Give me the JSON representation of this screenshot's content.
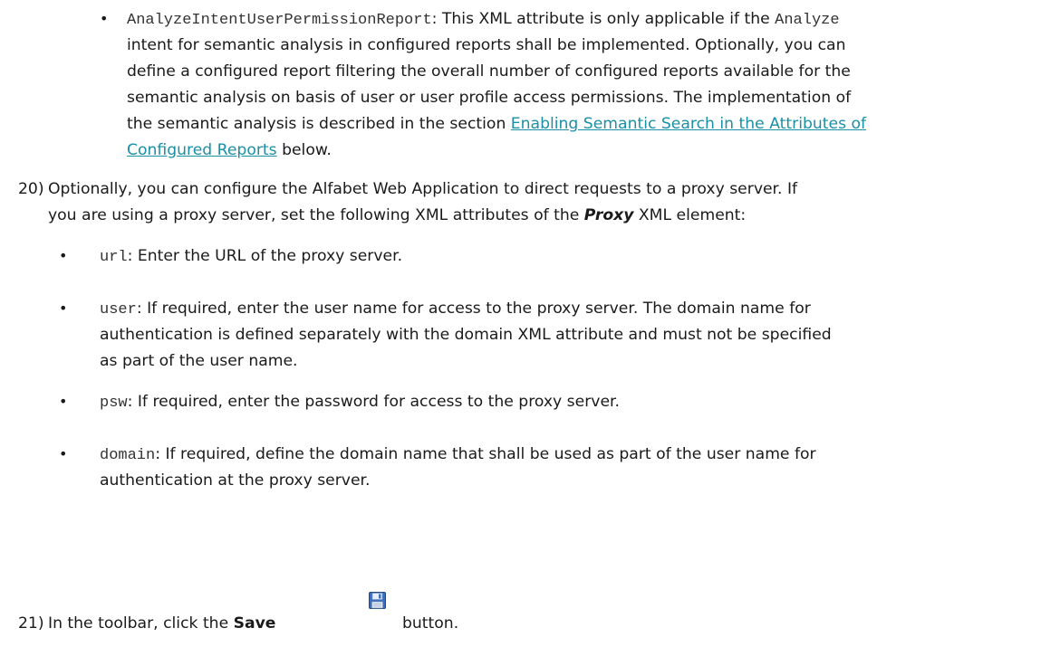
{
  "bullets_top": {
    "b1": {
      "marker": "•",
      "code": "AnalyzeIntentUserPermissionReport",
      "l1_text": ": This XML attribute is only applicable if the ",
      "l1_code2": "Analyze",
      "l2": "intent for semantic analysis in configured reports shall be implemented. Optionally, you can",
      "l3": "define a configured report filtering the overall number of configured reports available for the",
      "l4": "semantic analysis on basis of user or user profile access permissions. The implementation of",
      "l5_text": "the semantic analysis is described in the section ",
      "l5_link": "Enabling Semantic Search in the Attributes of",
      "l6_link": "Configured Reports",
      "l6_text": " below."
    }
  },
  "step20": {
    "number": "20)",
    "l1": "Optionally, you can configure the Alfabet Web Application to direct requests to a proxy server. If",
    "l2_a": "you are using a proxy server, set the following XML attributes of the ",
    "l2_em": "Proxy",
    "l2_b": " XML element:"
  },
  "proxy_bullets": [
    {
      "marker": "•",
      "code": "url",
      "lines": [
        ": Enter the URL of the proxy server."
      ]
    },
    {
      "marker": "•",
      "code": "user",
      "lines": [
        ": If required, enter the user name for access to the proxy server. The domain name for",
        "authentication is defined separately with the domain XML attribute and must not be specified",
        "as part of the user name."
      ]
    },
    {
      "marker": "•",
      "code": "psw",
      "lines": [
        ": If required, enter the password for access to the proxy server."
      ]
    },
    {
      "marker": "•",
      "code": "domain",
      "lines": [
        ": If required, define the domain name that shall be used as part of the user name for",
        "authentication at the proxy server."
      ]
    }
  ],
  "step21": {
    "number": "21)",
    "text_a": "In the toolbar, click the ",
    "bold": "Save",
    "text_b": "button.",
    "icon": "save-floppy-icon"
  },
  "colors": {
    "link": "#1b8fa6",
    "text": "#1a1a1a"
  }
}
